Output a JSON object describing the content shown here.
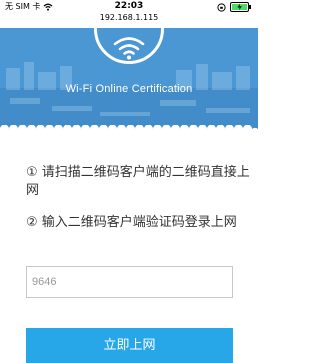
{
  "status_bar": {
    "carrier": "无 SIM 卡",
    "time": "22:03",
    "url": "192.168.1.115",
    "wifi_icon": "wifi-icon",
    "lock_icon": "rotation-lock-icon",
    "battery_icon": "battery-charging-icon"
  },
  "hero": {
    "title": "Wi-Fi Online Certification",
    "icon": "wifi-icon",
    "bg_color": "#3f8fcf"
  },
  "instructions": {
    "step1": "① 请扫描二维码客户端的二维码直接上网",
    "step2": "② 输入二维码客户端验证码登录上网"
  },
  "code_input": {
    "value": "9646",
    "placeholder": ""
  },
  "connect_button": {
    "label": "立即上网",
    "color": "#28a7e8"
  }
}
